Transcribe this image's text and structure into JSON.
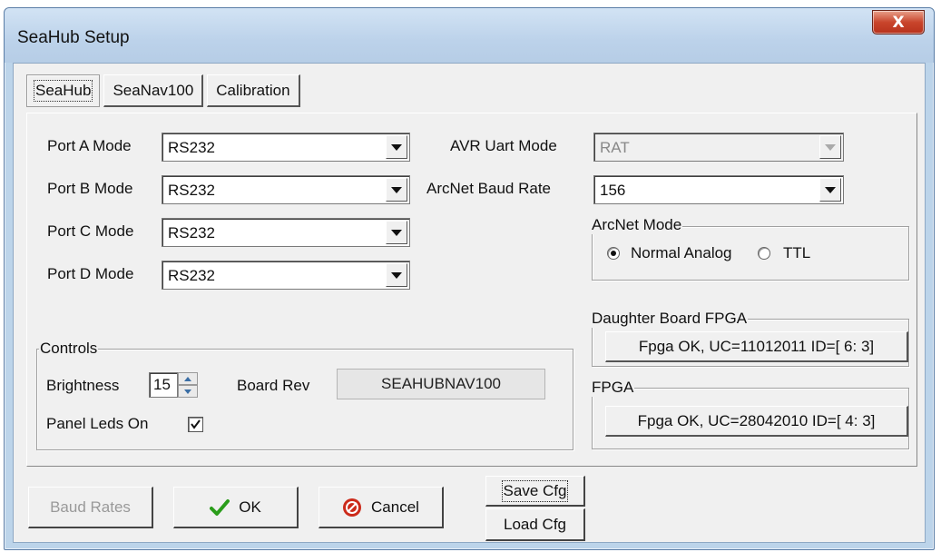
{
  "window": {
    "title": "SeaHub Setup",
    "close_glyph": "X"
  },
  "tabs": [
    {
      "label": "SeaHub",
      "active": true
    },
    {
      "label": "SeaNav100",
      "active": false
    },
    {
      "label": "Calibration",
      "active": false
    }
  ],
  "ports": [
    {
      "label": "Port A Mode",
      "value": "RS232"
    },
    {
      "label": "Port B Mode",
      "value": "RS232"
    },
    {
      "label": "Port C Mode",
      "value": "RS232"
    },
    {
      "label": "Port D Mode",
      "value": "RS232"
    }
  ],
  "avr": {
    "label": "AVR Uart Mode",
    "value": "RAT",
    "enabled": false
  },
  "arcnet_baud": {
    "label": "ArcNet Baud Rate",
    "value": "156"
  },
  "arcnet_mode": {
    "title": "ArcNet Mode",
    "options": [
      {
        "label": "Normal Analog",
        "selected": true
      },
      {
        "label": "TTL",
        "selected": false
      }
    ]
  },
  "daughter_fpga": {
    "title": "Daughter Board FPGA",
    "status": "Fpga OK, UC=11012011 ID=[ 6: 3]"
  },
  "fpga": {
    "title": "FPGA",
    "status": "Fpga OK, UC=28042010 ID=[ 4: 3]"
  },
  "controls": {
    "title": "Controls",
    "brightness_label": "Brightness",
    "brightness_value": "15",
    "board_rev_label": "Board Rev",
    "board_rev_value": "SEAHUBNAV100",
    "panel_leds_label": "Panel Leds On",
    "panel_leds_checked": true
  },
  "buttons": {
    "baud_rates": "Baud Rates",
    "ok": "OK",
    "cancel": "Cancel",
    "save_cfg": "Save Cfg",
    "load_cfg": "Load Cfg"
  },
  "icons": {
    "ok": "checkmark-icon",
    "cancel": "no-entry-icon",
    "close": "close-icon"
  },
  "colors": {
    "ok_icon": "#2a9d1a",
    "cancel_icon": "#cc2a1a",
    "close_button": "#c9452c"
  }
}
